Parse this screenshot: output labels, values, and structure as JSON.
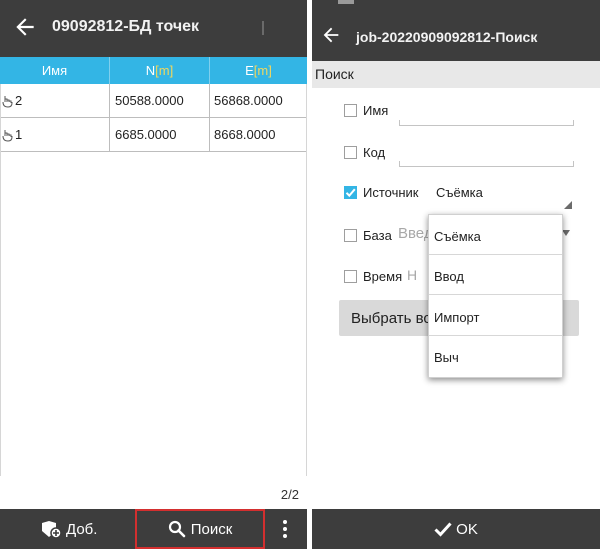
{
  "left_screen": {
    "title": "09092812-БД точек",
    "table": {
      "columns": [
        {
          "name": "Имя",
          "unit": ""
        },
        {
          "name": "N",
          "unit": "[m]"
        },
        {
          "name": "E",
          "unit": "[m]"
        }
      ],
      "rows": [
        {
          "name": "2",
          "n": "50588.0000",
          "e": "56868.0000"
        },
        {
          "name": "1",
          "n": "6685.0000",
          "e": "8668.0000"
        }
      ]
    },
    "pager": "2/2",
    "bottom": {
      "add_label": "Доб.",
      "search_label": "Поиск"
    }
  },
  "right_screen": {
    "title": "job-20220909092812-Поиск",
    "section_title": "Поиск",
    "fields": {
      "name": {
        "label": "Имя",
        "checked": false
      },
      "code": {
        "label": "Код",
        "checked": false
      },
      "source": {
        "label": "Источник",
        "checked": true,
        "value": "Съёмка"
      },
      "base": {
        "label": "База",
        "checked": false,
        "placeholder": "Введ"
      },
      "time": {
        "label": "Время",
        "checked": false,
        "value": "Н"
      }
    },
    "select_button": "Выбрать вс",
    "dropdown_options": [
      "Съёмка",
      "Ввод",
      "Импорт",
      "Выч"
    ],
    "ok_label": "OK"
  },
  "colors": {
    "appbar": "#3d3d3d",
    "accent": "#33b5e5",
    "unit": "#f2d75c",
    "highlight_border": "#d32f2f"
  }
}
